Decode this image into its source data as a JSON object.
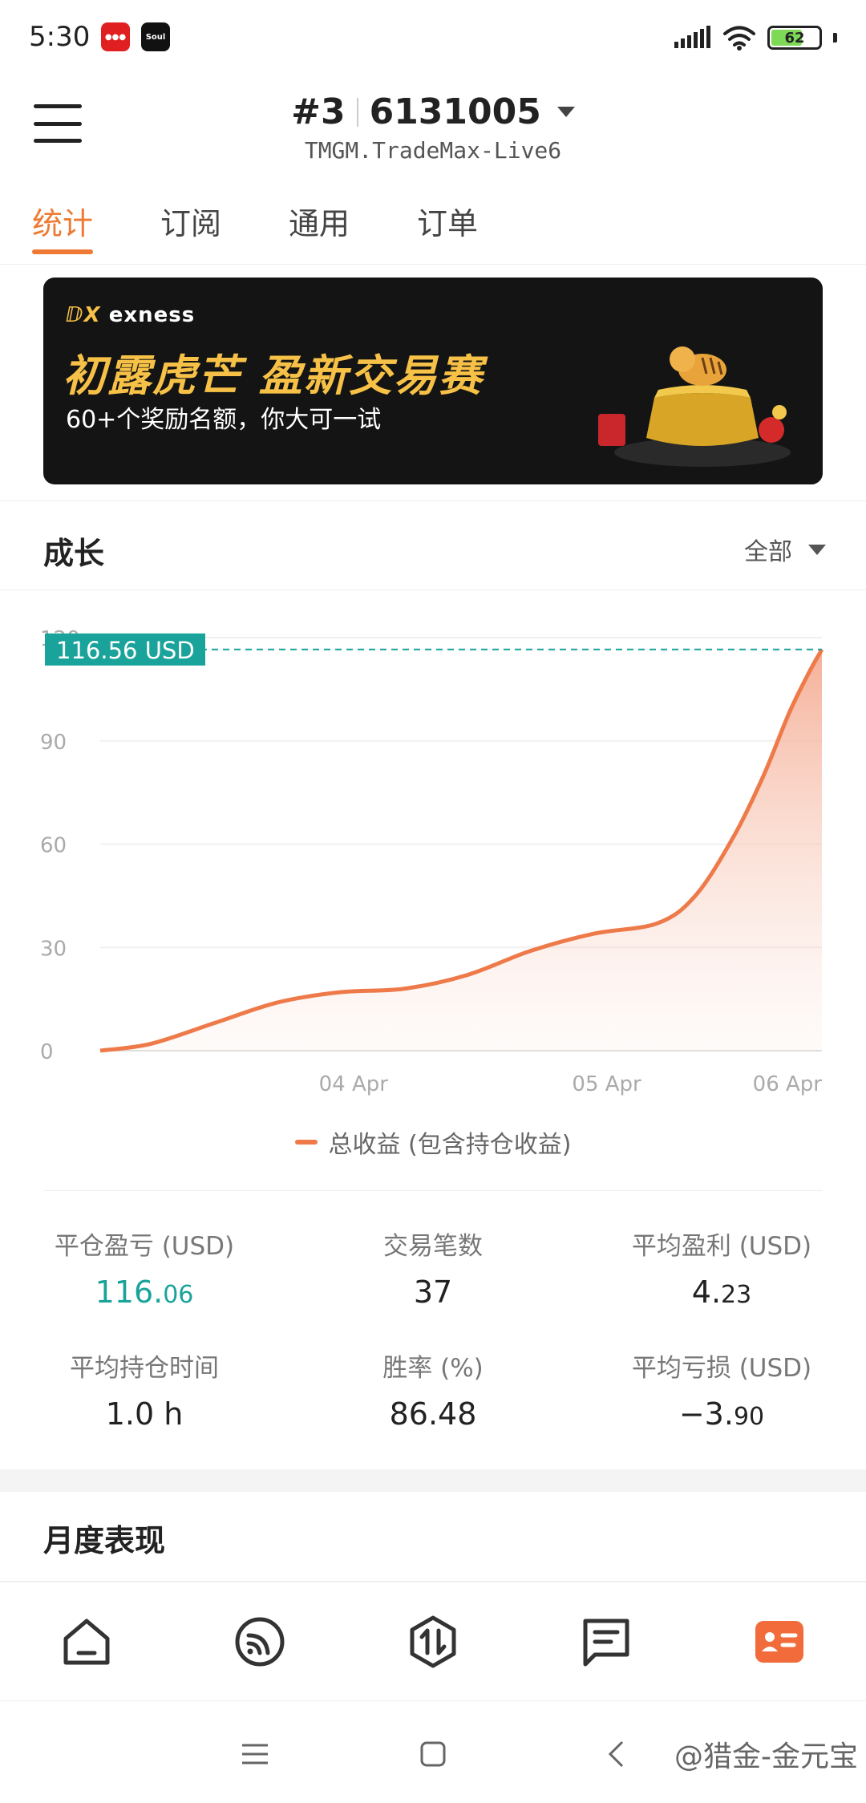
{
  "status_bar": {
    "time": "5:30",
    "app_icons": [
      "app-notification-icon",
      "soul-app-icon"
    ],
    "soul_label": "Soul",
    "battery": "62"
  },
  "header": {
    "account_prefix": "#3",
    "account_number": "6131005",
    "server": "TMGM.TradeMax-Live6"
  },
  "tabs": [
    {
      "label": "统计",
      "active": true
    },
    {
      "label": "订阅",
      "active": false
    },
    {
      "label": "通用",
      "active": false
    },
    {
      "label": "订单",
      "active": false
    }
  ],
  "banner": {
    "brand": "exness",
    "title": "初露虎芒 盈新交易赛",
    "subtitle": "60+个奖励名额，你大可一试"
  },
  "growth": {
    "title": "成长",
    "range": "全部",
    "current_label": "116.56 USD",
    "legend": "总收益 (包含持仓收益)"
  },
  "chart_data": {
    "type": "area",
    "ylim": [
      0,
      120
    ],
    "yticks": [
      0,
      30,
      60,
      90,
      120
    ],
    "xticks": [
      {
        "label": "04 Apr",
        "x": 1
      },
      {
        "label": "05 Apr",
        "x": 2
      },
      {
        "label": "06 Apr",
        "x": 2.85
      }
    ],
    "series": [
      {
        "name": "总收益 (包含持仓收益)",
        "color": "#ee7a4a",
        "points": [
          [
            0,
            0
          ],
          [
            0.2,
            2
          ],
          [
            0.45,
            8
          ],
          [
            0.7,
            14
          ],
          [
            0.95,
            17
          ],
          [
            1.2,
            18
          ],
          [
            1.45,
            22
          ],
          [
            1.7,
            29
          ],
          [
            1.95,
            34
          ],
          [
            2.2,
            37
          ],
          [
            2.35,
            45
          ],
          [
            2.5,
            62
          ],
          [
            2.62,
            80
          ],
          [
            2.72,
            98
          ],
          [
            2.8,
            110
          ],
          [
            2.85,
            116.56
          ]
        ]
      }
    ],
    "current_value": 116.56
  },
  "stats": [
    {
      "label": "平仓盈亏 (USD)",
      "value_main": "116.",
      "value_small": "06",
      "color": "green"
    },
    {
      "label": "交易笔数",
      "value_main": "37",
      "value_small": "",
      "color": "normal"
    },
    {
      "label": "平均盈利 (USD)",
      "value_main": "4.",
      "value_small": "23",
      "color": "normal"
    },
    {
      "label": "平均持仓时间",
      "value_main": "1.0 h",
      "value_small": "",
      "color": "normal"
    },
    {
      "label": "胜率 (%)",
      "value_main": "86.48",
      "value_small": "",
      "color": "normal"
    },
    {
      "label": "平均亏损 (USD)",
      "value_main": "−3.",
      "value_small": "90",
      "color": "normal"
    }
  ],
  "monthly": {
    "title": "月度表现"
  },
  "bottom_nav": [
    "home-icon",
    "feed-icon",
    "trade-icon",
    "orders-icon",
    "profile-icon"
  ],
  "watermark": "@猎金-金元宝"
}
